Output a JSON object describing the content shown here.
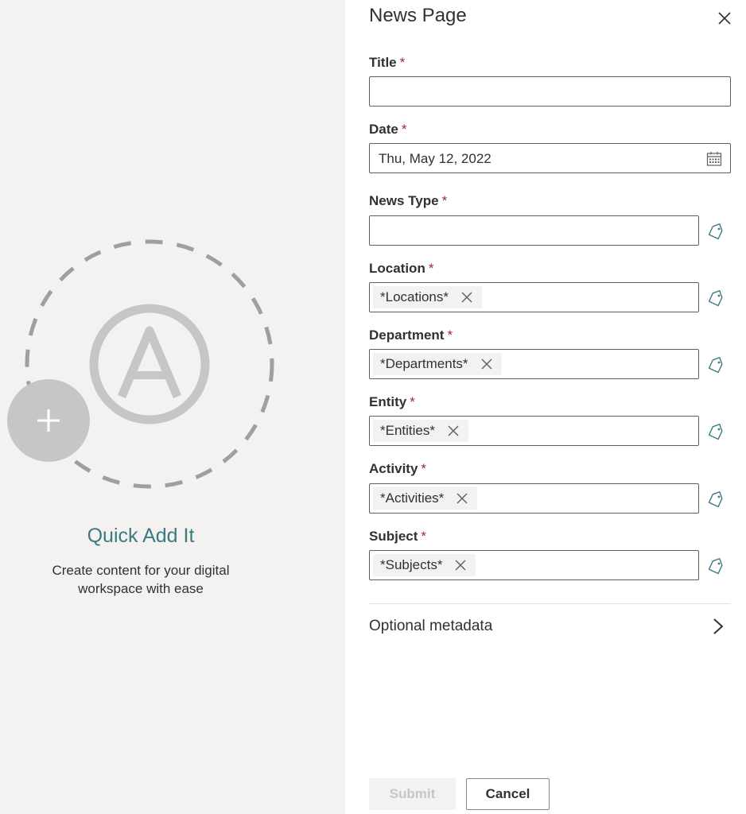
{
  "brand": {
    "title": "Quick Add It",
    "subtitle": "Create content for your digital workspace with ease"
  },
  "panel": {
    "title": "News Page",
    "close_icon": "close-icon",
    "required_marker": "*"
  },
  "fields": {
    "title": {
      "label": "Title",
      "value": ""
    },
    "date": {
      "label": "Date",
      "value": "Thu, May 12, 2022",
      "icon": "calendar-icon"
    },
    "news_type": {
      "label": "News Type",
      "value": "",
      "icon": "tag-icon"
    },
    "location": {
      "label": "Location",
      "chip": "*Locations*",
      "icon": "tag-icon"
    },
    "department": {
      "label": "Department",
      "chip": "*Departments*",
      "icon": "tag-icon"
    },
    "entity": {
      "label": "Entity",
      "chip": "*Entities*",
      "icon": "tag-icon"
    },
    "activity": {
      "label": "Activity",
      "chip": "*Activities*",
      "icon": "tag-icon"
    },
    "subject": {
      "label": "Subject",
      "chip": "*Subjects*",
      "icon": "tag-icon"
    }
  },
  "optional": {
    "label": "Optional metadata",
    "icon": "chevron-right-icon"
  },
  "buttons": {
    "submit": "Submit",
    "cancel": "Cancel"
  },
  "colors": {
    "accent": "#3b7b82",
    "required": "#a4262c",
    "left_bg": "#f3f2f1",
    "disabled_text": "#c8c6c4"
  }
}
